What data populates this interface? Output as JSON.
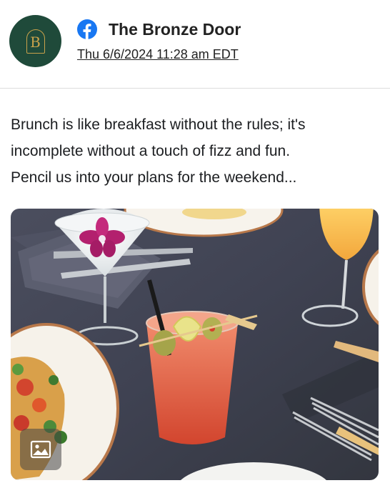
{
  "post": {
    "page_name": "The Bronze Door",
    "timestamp": "Thu 6/6/2024 11:28 am EDT",
    "avatar_letter": "B",
    "lines": [
      "Brunch is like breakfast without the rules; it's",
      "incomplete without a touch of fizz and fun.",
      "Pencil us into your plans for the weekend..."
    ]
  },
  "icons": {
    "platform": "facebook-icon",
    "media_type": "image-icon"
  },
  "colors": {
    "facebook_blue": "#1877f2",
    "avatar_green": "#1f4a3a",
    "avatar_gold": "#c9a24b"
  }
}
